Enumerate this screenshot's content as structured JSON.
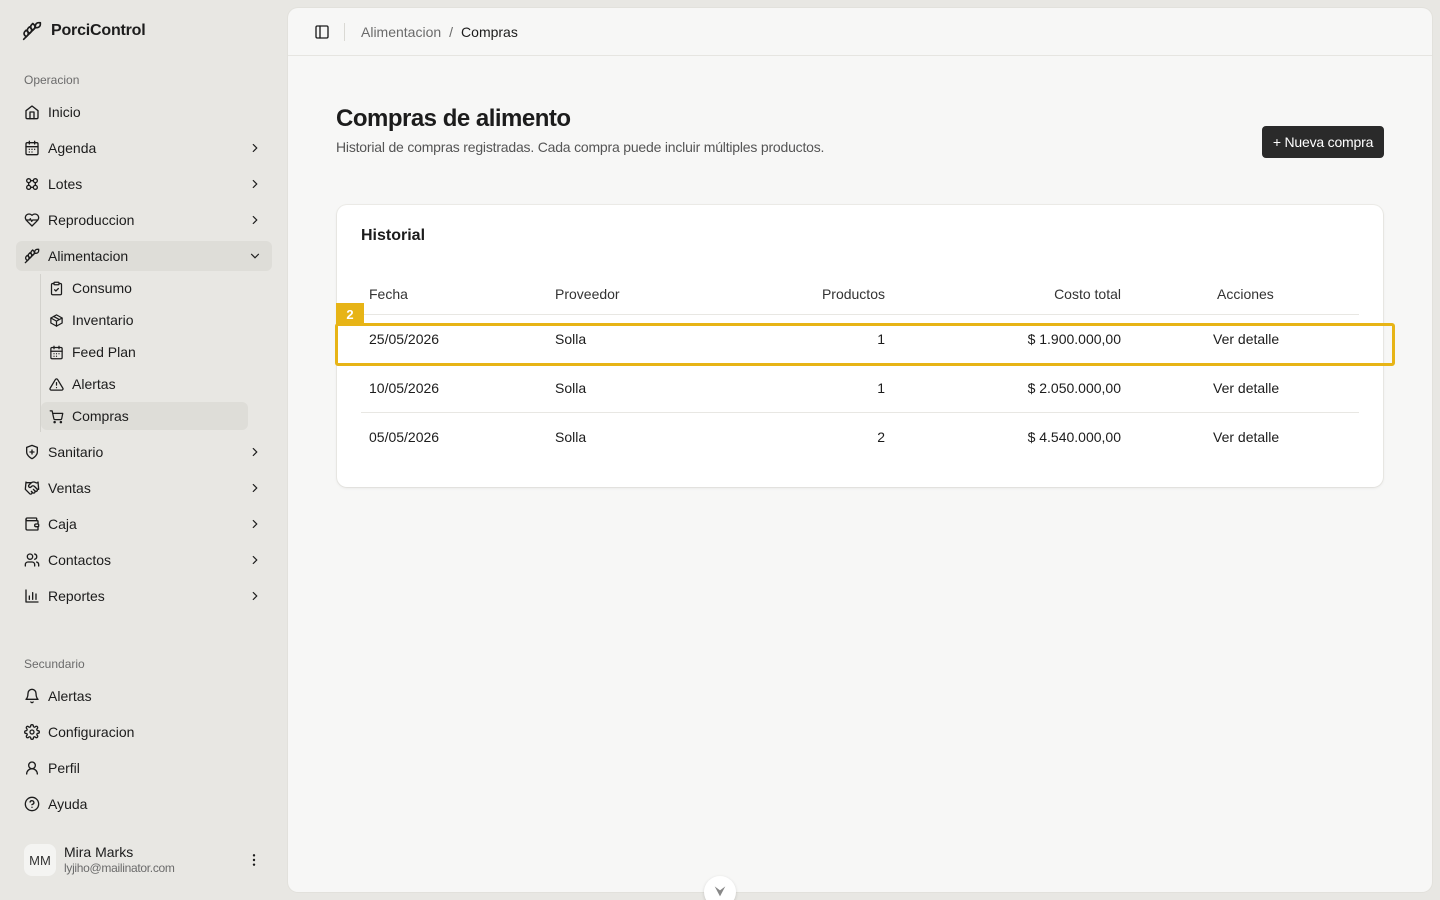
{
  "app": {
    "name": "PorciControl"
  },
  "sidebar": {
    "groups": {
      "operacion": "Operacion",
      "secundario": "Secundario"
    },
    "items": {
      "inicio": "Inicio",
      "agenda": "Agenda",
      "lotes": "Lotes",
      "reproduccion": "Reproduccion",
      "alimentacion": "Alimentacion",
      "sanitario": "Sanitario",
      "ventas": "Ventas",
      "caja": "Caja",
      "contactos": "Contactos",
      "reportes": "Reportes"
    },
    "alimentacion_sub": {
      "consumo": "Consumo",
      "inventario": "Inventario",
      "feed_plan": "Feed Plan",
      "alertas": "Alertas",
      "compras": "Compras"
    },
    "secondary": {
      "alertas": "Alertas",
      "configuracion": "Configuracion",
      "perfil": "Perfil",
      "ayuda": "Ayuda"
    },
    "user": {
      "initials": "MM",
      "name": "Mira Marks",
      "email": "lyjiho@mailinator.com"
    }
  },
  "breadcrumb": {
    "parent": "Alimentacion",
    "separator": "/",
    "current": "Compras"
  },
  "page": {
    "title": "Compras de alimento",
    "subtitle": "Historial de compras registradas. Cada compra puede incluir múltiples productos.",
    "new_button": "+ Nueva compra"
  },
  "history": {
    "title": "Historial",
    "columns": {
      "fecha": "Fecha",
      "proveedor": "Proveedor",
      "productos": "Productos",
      "costo": "Costo total",
      "acciones": "Acciones"
    },
    "rows": [
      {
        "fecha": "25/05/2026",
        "proveedor": "Solla",
        "productos": "1",
        "costo": "$ 1.900.000,00",
        "accion": "Ver detalle"
      },
      {
        "fecha": "10/05/2026",
        "proveedor": "Solla",
        "productos": "1",
        "costo": "$ 2.050.000,00",
        "accion": "Ver detalle"
      },
      {
        "fecha": "05/05/2026",
        "proveedor": "Solla",
        "productos": "2",
        "costo": "$ 4.540.000,00",
        "accion": "Ver detalle"
      }
    ]
  },
  "highlight": {
    "badge": "2",
    "color": "#e7b416"
  },
  "colors": {
    "sidebar_bg": "#e8e7e3",
    "panel_bg": "#f7f7f6",
    "primary_button": "#2a2a2a"
  }
}
